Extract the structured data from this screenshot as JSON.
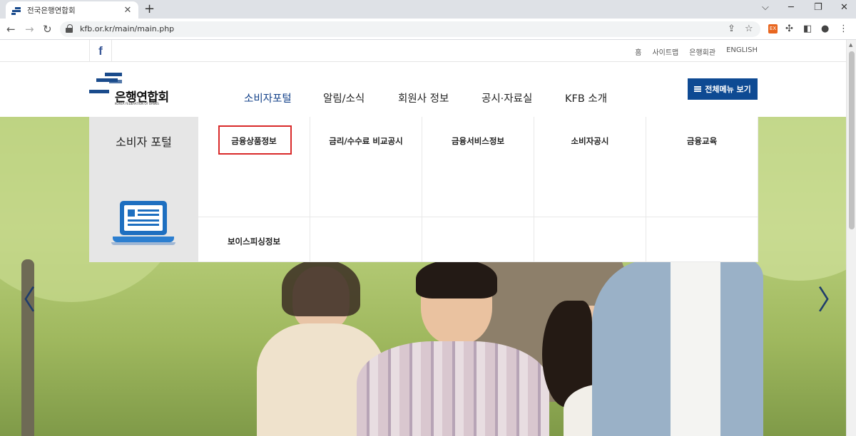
{
  "browser": {
    "tab_title": "전국은행연합회",
    "tab_close": "✕",
    "new_tab": "+",
    "url": "kfb.or.kr/main/main.php",
    "ext_label": "EX"
  },
  "util": {
    "facebook": "f",
    "links": [
      "홈",
      "사이트맵",
      "은행회관",
      "ENGLISH"
    ]
  },
  "logo": {
    "name": "은행연합회",
    "sub": "KOREA FEDERATION OF BANKS"
  },
  "gnb": {
    "items": [
      "소비자포털",
      "알림/소식",
      "회원사 정보",
      "공시·자료실",
      "KFB 소개"
    ],
    "all_menu": "전체메뉴 보기"
  },
  "mega": {
    "title": "소비자 포털",
    "row1": [
      "금융상품정보",
      "금리/수수료 비교공시",
      "금융서비스정보",
      "소비자공시",
      "금융교육"
    ],
    "row2": [
      "보이스피싱정보"
    ]
  },
  "hero": {
    "prev": "〈",
    "next": "〉"
  },
  "colors": {
    "brand": "#0e4a93",
    "highlight": "#d92a2a"
  }
}
